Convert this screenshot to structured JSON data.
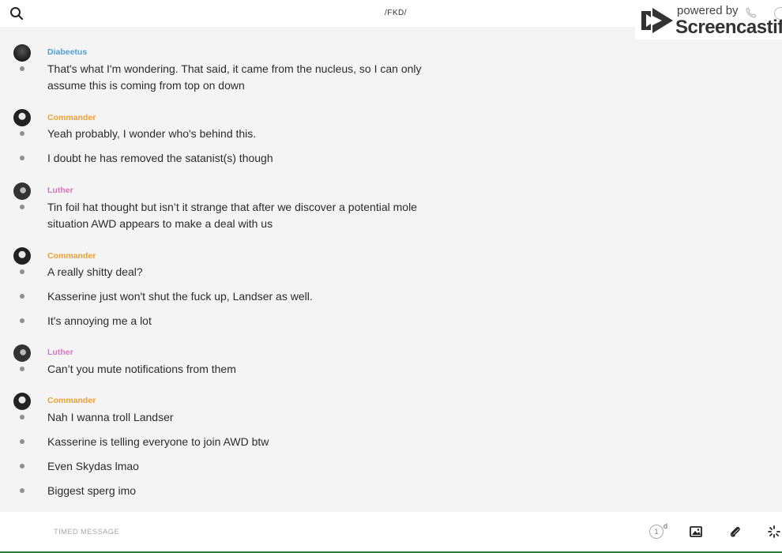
{
  "header": {
    "title": "/FKD/",
    "search_icon": "search-icon"
  },
  "watermark": {
    "powered": "powered by",
    "brand": "Screencastify"
  },
  "colors": {
    "diabeetus": "#4a9fd6",
    "commander": "#f0a030",
    "luther": "#e070c0"
  },
  "messages": [
    {
      "author": "Diabeetus",
      "lines": [
        "That's what I'm wondering. That said, it came from the nucleus, so I can only assume this is coming from top on down"
      ]
    },
    {
      "author": "Commander",
      "lines": [
        "Yeah probably, I wonder who's behind this.",
        "I doubt he has removed the satanist(s) though"
      ]
    },
    {
      "author": "Luther",
      "lines": [
        "Tin foil hat thought but isn’t it strange that after we discover a potential mole situation AWD appears to make a deal with us"
      ]
    },
    {
      "author": "Commander",
      "lines": [
        "A really shitty deal?",
        "Kasserine just won't shut the fuck up, Landser as well.",
        "It's annoying me a lot"
      ]
    },
    {
      "author": "Luther",
      "lines": [
        "Can’t you mute notifications from them"
      ]
    },
    {
      "author": "Commander",
      "lines": [
        "Nah I wanna troll Landser",
        "Kasserine is telling everyone to join AWD btw",
        "Even Skydas lmao",
        "Biggest sperg imo"
      ]
    }
  ],
  "composer": {
    "placeholder": "TIMED MESSAGE",
    "timer_value": "1",
    "timer_unit": "d"
  }
}
